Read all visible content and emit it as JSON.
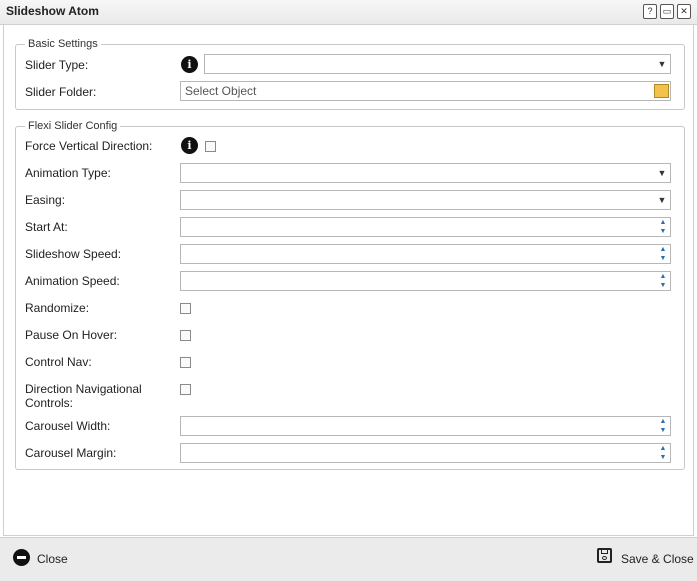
{
  "window": {
    "title": "Slideshow Atom",
    "help_icon": "question-icon",
    "maximize_icon": "maximize-icon",
    "close_icon": "close-icon"
  },
  "basic_settings": {
    "legend": "Basic Settings",
    "slider_type": {
      "label": "Slider Type:",
      "value": ""
    },
    "slider_folder": {
      "label": "Slider Folder:",
      "placeholder": "Select Object"
    }
  },
  "flexi_config": {
    "legend": "Flexi Slider Config",
    "force_vertical_direction": {
      "label": "Force Vertical Direction:"
    },
    "animation_type": {
      "label": "Animation Type:",
      "value": ""
    },
    "easing": {
      "label": "Easing:",
      "value": ""
    },
    "start_at": {
      "label": "Start At:",
      "value": ""
    },
    "slideshow_speed": {
      "label": "Slideshow Speed:",
      "value": ""
    },
    "animation_speed": {
      "label": "Animation Speed:",
      "value": ""
    },
    "randomize": {
      "label": "Randomize:"
    },
    "pause_on_hover": {
      "label": "Pause On Hover:"
    },
    "control_nav": {
      "label": "Control Nav:"
    },
    "direction_nav": {
      "label_line1": "Direction Navigational",
      "label_line2": "Controls:"
    },
    "carousel_width": {
      "label": "Carousel Width:",
      "value": ""
    },
    "carousel_margin": {
      "label": "Carousel Margin:",
      "value": ""
    }
  },
  "footer": {
    "close_label": "Close",
    "save_close_label": "Save & Close"
  }
}
